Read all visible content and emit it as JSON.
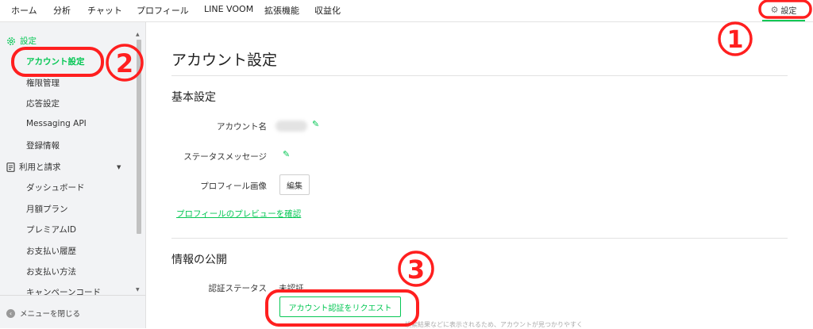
{
  "nav": {
    "items": [
      "ホーム",
      "分析",
      "チャット",
      "プロフィール",
      "LINE VOOM",
      "拡張機能",
      "収益化"
    ],
    "settings_label": "設定"
  },
  "sidebar": {
    "settings_header": "設定",
    "settings_items": [
      "アカウント設定",
      "権限管理",
      "応答設定",
      "Messaging API",
      "登録情報"
    ],
    "billing_header": "利用と請求",
    "billing_items": [
      "ダッシュボード",
      "月額プラン",
      "プレミアムID",
      "お支払い履歴",
      "お支払い方法",
      "キャンペーンコード"
    ],
    "close_menu": "メニューを閉じる"
  },
  "main": {
    "title": "アカウント設定",
    "basic": {
      "title": "基本設定",
      "account_name_label": "アカウント名",
      "status_message_label": "ステータスメッセージ",
      "profile_image_label": "プロフィール画像",
      "edit_button": "編集",
      "preview_link": "プロフィールのプレビューを確認"
    },
    "publish": {
      "title": "情報の公開",
      "verification_label": "認証ステータス",
      "verification_value": "未認証",
      "request_button": "アカウント認証をリクエスト",
      "note": "検索結果などに表示されるため、アカウントが見つかりやすく"
    }
  },
  "annotations": {
    "step1": "1",
    "step2": "2",
    "step3": "3",
    "color": "#ff1f1f"
  },
  "colors": {
    "accent": "#06c755"
  }
}
